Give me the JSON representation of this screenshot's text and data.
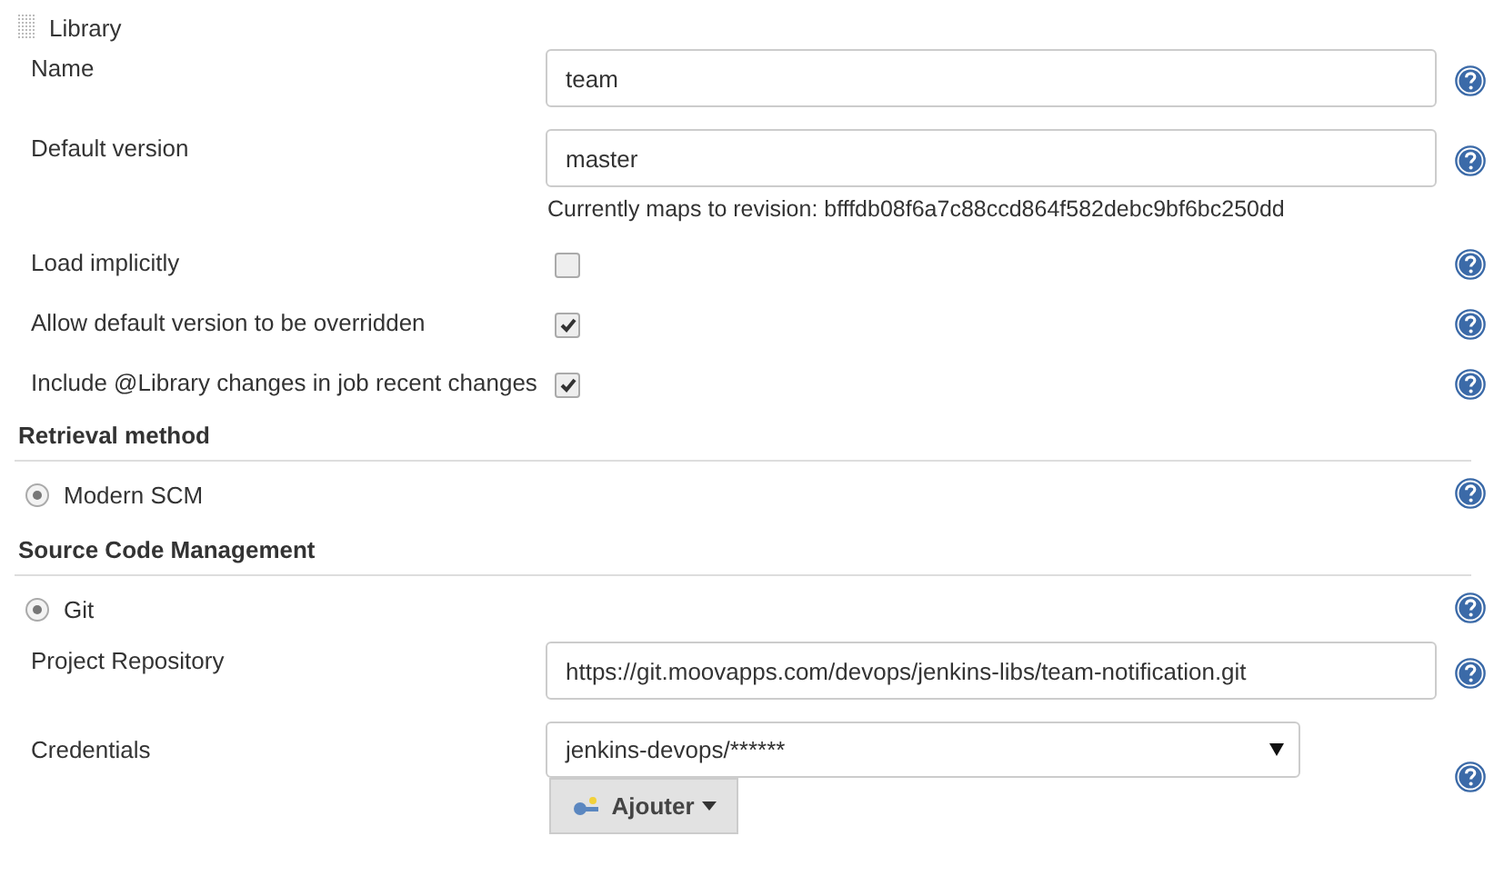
{
  "library": {
    "title": "Library"
  },
  "rows": [
    {
      "kind": "text",
      "label": "Name",
      "value": "team"
    },
    {
      "kind": "text",
      "label": "Default version",
      "value": "master",
      "note": "Currently maps to revision: bfffdb08f6a7c88ccd864f582debc9bf6bc250dd"
    },
    {
      "kind": "checkbox",
      "label": "Load implicitly",
      "checked": false
    },
    {
      "kind": "checkbox",
      "label": "Allow default version to be overridden",
      "checked": true
    },
    {
      "kind": "checkbox",
      "label": "Include @Library changes in job recent changes",
      "checked": true
    },
    {
      "kind": "section",
      "label": "Retrieval method"
    },
    {
      "kind": "radio",
      "label": "Modern SCM",
      "selected": true
    },
    {
      "kind": "section",
      "label": "Source Code Management"
    },
    {
      "kind": "radio",
      "label": "Git",
      "selected": true
    },
    {
      "kind": "text",
      "label": "Project Repository",
      "value": "https://git.moovapps.com/devops/jenkins-libs/team-notification.git"
    },
    {
      "kind": "select",
      "label": "Credentials",
      "value": "jenkins-devops/******",
      "button": "Ajouter"
    }
  ]
}
